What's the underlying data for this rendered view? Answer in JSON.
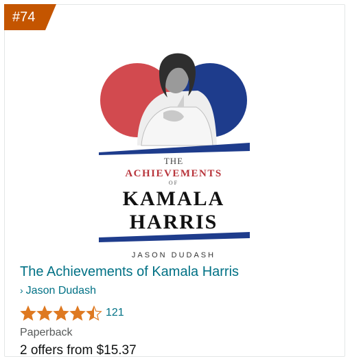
{
  "badge": {
    "rank": "#74",
    "color": "#c45500"
  },
  "book": {
    "cover": {
      "line_the": "THE",
      "line_achievements": "ACHIEVEMENTS",
      "line_of": "OF",
      "line_kamala": "KAMALA",
      "line_harris": "HARRIS",
      "line_author": "JASON DUDASH",
      "colors": {
        "red": "#d24a4f",
        "blue": "#1e3c8c",
        "achievements_red": "#b8343b"
      }
    },
    "title": "The Achievements of Kamala Harris",
    "author_chevron": "›",
    "author": "Jason Dudash",
    "rating": {
      "stars": 4.5,
      "count": "121",
      "star_color": "#de7921"
    },
    "format": "Paperback",
    "offers": "2 offers from $15.37"
  },
  "link_color": "#007185"
}
